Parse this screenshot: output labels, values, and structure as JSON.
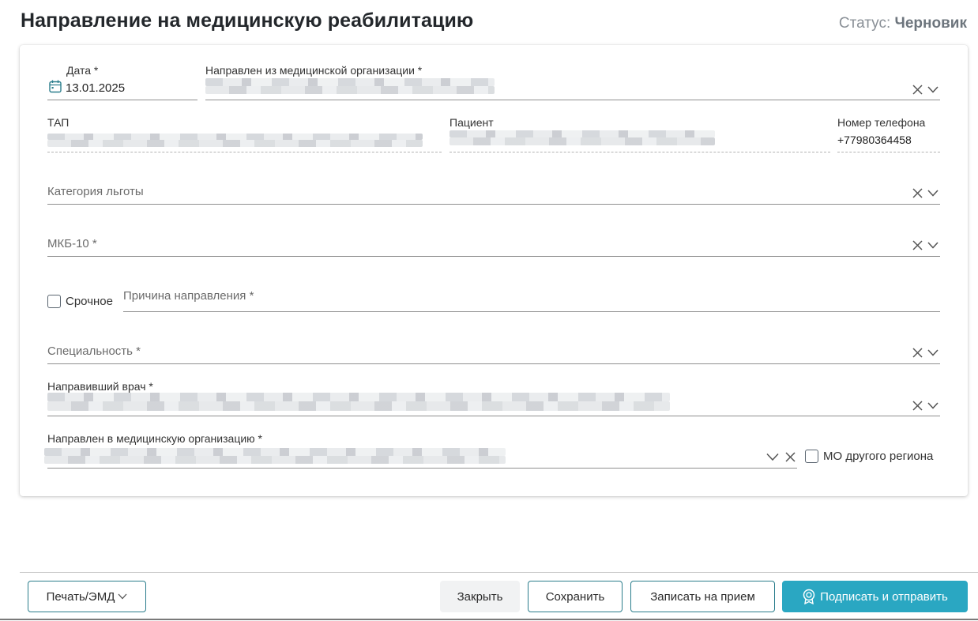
{
  "header": {
    "title": "Направление на медицинскую реабилитацию",
    "status_label": "Статус:",
    "status_value": "Черновик"
  },
  "form": {
    "date": {
      "label": "Дата *",
      "value": "13.01.2025"
    },
    "referred_from": {
      "label": "Направлен из медицинской организации *"
    },
    "tap": {
      "label": "ТАП"
    },
    "patient": {
      "label": "Пациент"
    },
    "phone": {
      "label": "Номер телефона",
      "value": "+77980364458"
    },
    "benefit_category": {
      "placeholder": "Категория льготы"
    },
    "icd10": {
      "placeholder": "МКБ-10 *"
    },
    "urgent": {
      "label": "Срочное",
      "checked": false
    },
    "reason": {
      "placeholder": "Причина направления *"
    },
    "specialty": {
      "placeholder": "Специальность *"
    },
    "referring_doctor": {
      "label": "Направивший врач *"
    },
    "referred_to": {
      "label": "Направлен в медицинскую организацию *"
    },
    "other_region": {
      "label": "МО другого региона",
      "checked": false
    }
  },
  "footer": {
    "print_label": "Печать/ЭМД",
    "close_label": "Закрыть",
    "save_label": "Сохранить",
    "appointment_label": "Записать на прием",
    "sign_send_label": "Подписать и отправить"
  },
  "colors": {
    "primary": "#2aa7c2",
    "outline": "#2a7d8c",
    "status_text": "#6d757d"
  },
  "icons": [
    "calendar-icon",
    "clear-icon",
    "chevron-down-icon",
    "checkmark-icon",
    "seal-icon"
  ]
}
